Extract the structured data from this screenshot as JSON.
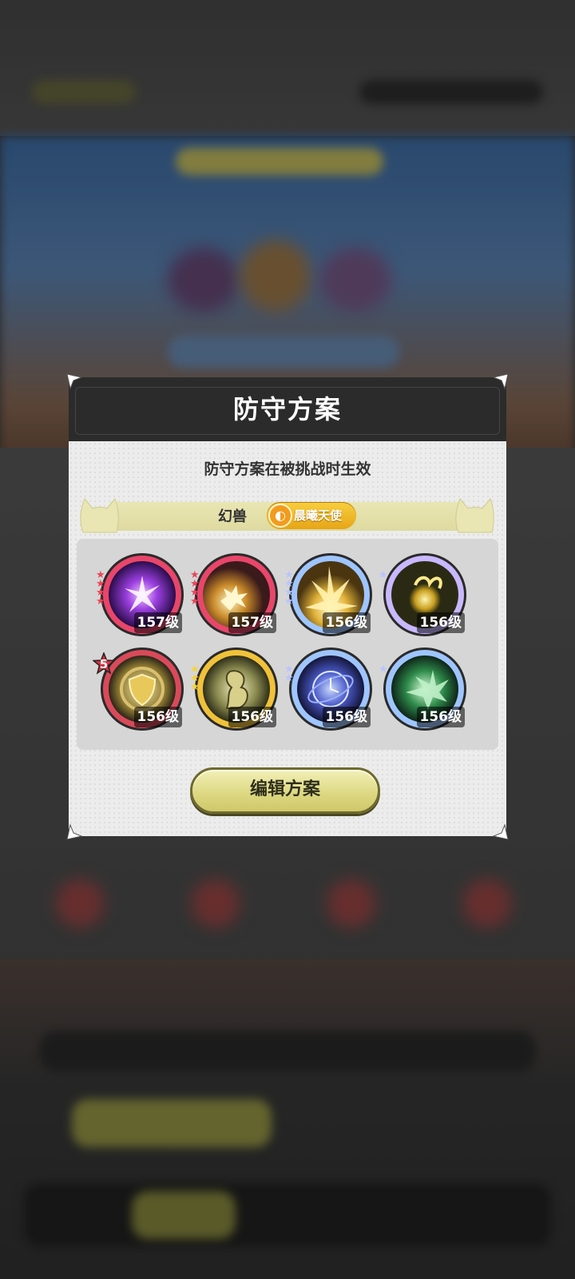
{
  "dialog": {
    "title": "防守方案",
    "subtitle": "防守方案在被挑战时生效",
    "pet": {
      "label": "幻兽",
      "name": "晨曦天使"
    },
    "edit_button": "编辑方案"
  },
  "skills": [
    {
      "level": "157级",
      "stars": 4,
      "star_color": "#e8465a",
      "ring_color": "#e8466a",
      "theme": "purple-orb"
    },
    {
      "level": "157级",
      "stars": 4,
      "star_color": "#e8465a",
      "ring_color": "#e8466a",
      "theme": "gold-burst"
    },
    {
      "level": "156级",
      "stars": 4,
      "star_color": "#b9c5ff",
      "ring_color": "#9fc5ff",
      "theme": "gold-strike"
    },
    {
      "level": "156级",
      "stars": 1,
      "star_color": "#b9c5ff",
      "ring_color": "#c9b8ff",
      "theme": "gold-spirit"
    },
    {
      "level": "156级",
      "stars": 0,
      "star_color": "#e8465a",
      "ring_color": "#d84a5a",
      "theme": "shield",
      "rank_badge": "5"
    },
    {
      "level": "156级",
      "stars": 3,
      "star_color": "#f5d43a",
      "ring_color": "#f0c23a",
      "theme": "gold-armor"
    },
    {
      "level": "156级",
      "stars": 2,
      "star_color": "#b9c5ff",
      "ring_color": "#9fc5ff",
      "theme": "blue-clock"
    },
    {
      "level": "156级",
      "stars": 1,
      "star_color": "#b9c5ff",
      "ring_color": "#9fc5ff",
      "theme": "green-leaf"
    }
  ],
  "colors": {
    "header_bg": "#2b2b2b",
    "body_bg": "#ececec",
    "button_bg": "#dcd780",
    "pet_badge": "#f0b62a"
  }
}
